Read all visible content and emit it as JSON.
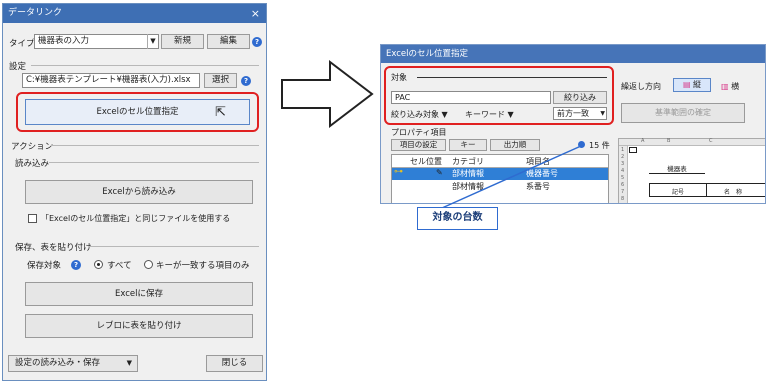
{
  "left_window": {
    "title": "データリンク",
    "close": "×",
    "type_label": "タイプ",
    "type_value": "機器表の入力",
    "new_btn": "新規",
    "edit_btn": "編集",
    "settings_label": "設定",
    "file_path": "C:¥機器表テンプレート¥機器表(入力).xlsx",
    "select_btn": "選択",
    "cell_pos_btn": "Excelのセル位置指定",
    "action_label": "アクション",
    "read_label": "読み込み",
    "read_excel_btn": "Excelから読み込み",
    "same_file_label": "「Excelのセル位置指定」と同じファイルを使用する",
    "save_paste_label": "保存、表を貼り付け",
    "save_target_label": "保存対象",
    "radio_all": "すべて",
    "radio_key": "キーが一致する項目のみ",
    "save_excel_btn": "Excelに保存",
    "paste_table_btn": "レブロに表を貼り付け",
    "settings_rw_btn": "設定の読み込み・保存",
    "close_btn": "閉じる"
  },
  "right_window": {
    "title": "Excelのセル位置指定",
    "target_label": "対象",
    "target_value": "PAC",
    "filter_btn": "絞り込み",
    "filter_target": "絞り込み対象",
    "keyword": "キーワード",
    "match_mode": "前方一致",
    "repeat_dir_label": "繰返し方向",
    "vertical": "縦",
    "horizontal": "横",
    "range_btn": "基準範囲の確定",
    "property_label": "プロパティ項目",
    "item_settings_btn": "項目の設定",
    "key_btn": "キー",
    "output_order_btn": "出力順",
    "count": "15 件",
    "columns": [
      "セル位置",
      "カテゴリ",
      "項目名"
    ],
    "rows": [
      {
        "category": "部材情報",
        "item": "機器番号"
      },
      {
        "category": "部材情報",
        "item": "系番号"
      }
    ],
    "sheet_title": "機器表",
    "sheet_col1": "記号",
    "sheet_col2": "名　称",
    "sheet_cols": [
      "A",
      "B",
      "C"
    ],
    "sheet_rows": [
      "1",
      "2",
      "3",
      "4",
      "5",
      "6",
      "7",
      "8",
      "9"
    ]
  },
  "callout": {
    "text": "対象の台数"
  },
  "colors": {
    "title_bar": "#3e6fb4",
    "highlight": "#e02020",
    "selection": "#2f7fd6",
    "callout": "#2f6bd0"
  }
}
